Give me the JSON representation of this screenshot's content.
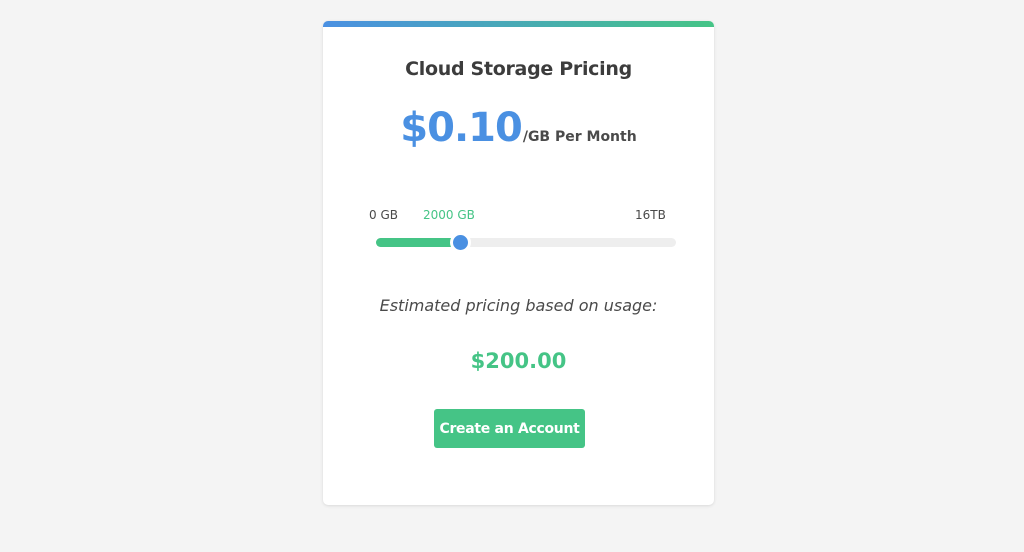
{
  "colors": {
    "page_background": "#f4f4f4",
    "card_background": "#ffffff",
    "accent_blue": "#4a90e2",
    "accent_green": "#45c486",
    "text_dark": "#3c3c3c"
  },
  "card": {
    "title": "Cloud Storage Pricing",
    "price": {
      "amount": "$0.10",
      "unit": "/GB Per Month"
    },
    "slider": {
      "min_label": "0 GB",
      "current_label": "2000 GB",
      "max_label": "16TB",
      "progress_fraction": 0.27
    },
    "estimate": {
      "label": "Estimated pricing based on usage:",
      "value": "$200.00"
    },
    "cta_label": "Create an Account"
  }
}
